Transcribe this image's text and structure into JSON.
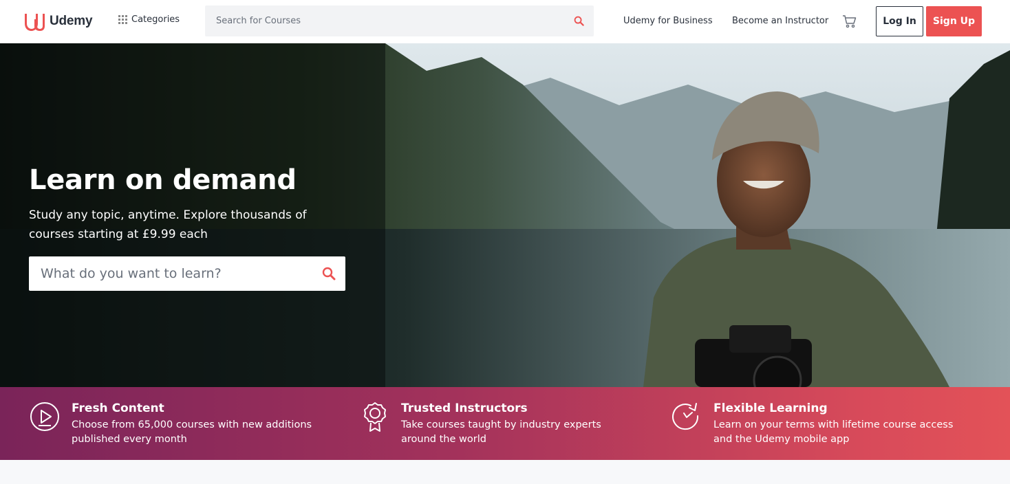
{
  "header": {
    "brand": "Udemy",
    "categories_label": "Categories",
    "search_placeholder": "Search for Courses",
    "business_link": "Udemy for Business",
    "instructor_link": "Become an Instructor",
    "login_label": "Log In",
    "signup_label": "Sign Up"
  },
  "hero": {
    "title": "Learn on demand",
    "subtitle": "Study any topic, anytime. Explore thousands of courses starting at £9.99 each",
    "search_placeholder": "What do you want to learn?"
  },
  "features": [
    {
      "icon": "play-circle-icon",
      "title": "Fresh Content",
      "description": "Choose from 65,000 courses with new additions published every month"
    },
    {
      "icon": "award-ribbon-icon",
      "title": "Trusted Instructors",
      "description": "Take courses taught by industry experts around the world"
    },
    {
      "icon": "refresh-clock-icon",
      "title": "Flexible Learning",
      "description": "Learn on your terms with lifetime course access and the Udemy mobile app"
    }
  ],
  "colors": {
    "brand": "#ec5252",
    "text": "#29303b",
    "band_start": "#7a2459",
    "band_end": "#e35258"
  }
}
